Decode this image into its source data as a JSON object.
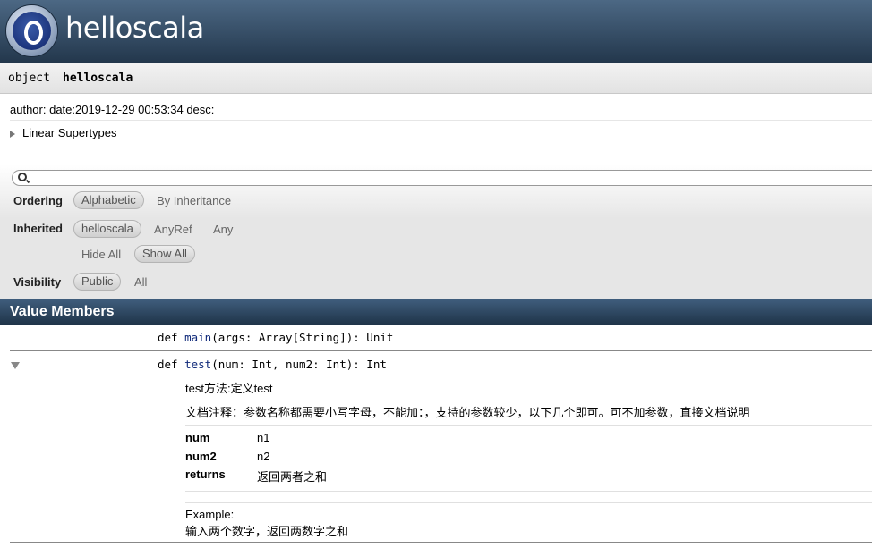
{
  "header": {
    "title": "helloscala",
    "logo_icon": "object-logo-icon"
  },
  "object_bar": {
    "keyword": "object",
    "name": "helloscala"
  },
  "comment": "author: date:2019-12-29 00:53:34 desc:",
  "linear_supertypes": "Linear Supertypes",
  "filter": {
    "search_placeholder": "",
    "ordering": {
      "label": "Ordering",
      "options": [
        "Alphabetic",
        "By Inheritance"
      ],
      "selected": "Alphabetic"
    },
    "inherited": {
      "label": "Inherited",
      "options": [
        "helloscala",
        "AnyRef",
        "Any"
      ],
      "selected": "helloscala",
      "hide_all": "Hide All",
      "show_all": "Show All"
    },
    "visibility": {
      "label": "Visibility",
      "options": [
        "Public",
        "All"
      ],
      "selected": "Public"
    }
  },
  "value_members": {
    "heading": "Value Members",
    "members": [
      {
        "kind": "def",
        "name": "main",
        "params": "(args: Array[String]): Unit"
      },
      {
        "kind": "def",
        "name": "test",
        "params": "(num: Int, num2: Int): Int",
        "short_comment": "test方法:定义test",
        "full_comment": "文档注释：参数名称都需要小写字母，不能加：，支持的参数较少，以下几个即可。可不加参数，直接文档说明",
        "params_table": [
          {
            "name": "num",
            "desc": "n1"
          },
          {
            "name": "num2",
            "desc": "n2"
          },
          {
            "name": "returns",
            "desc": "返回两者之和"
          }
        ],
        "example_label": "Example:",
        "example_text": "输入两个数字，返回两数字之和"
      }
    ]
  }
}
